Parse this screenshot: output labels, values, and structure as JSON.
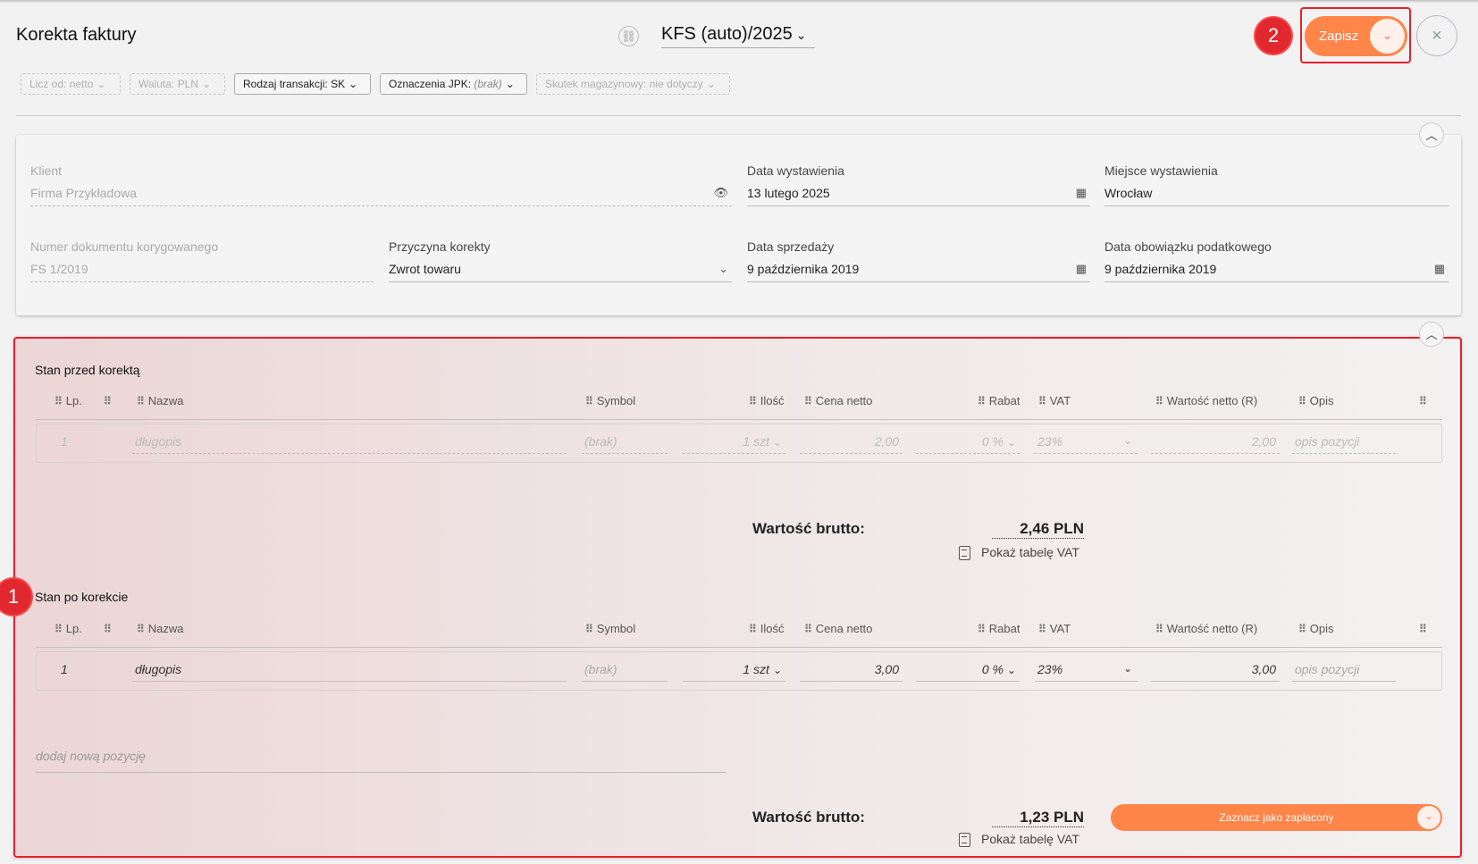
{
  "header": {
    "title": "Korekta faktury",
    "document_number": "KFS (auto)/2025",
    "save_label": "Zapisz",
    "close_label": "×",
    "badge_save": "2"
  },
  "filters": [
    {
      "label": "Licz od:",
      "value": "netto",
      "enabled": false
    },
    {
      "label": "Waluta:",
      "value": "PLN",
      "enabled": false
    },
    {
      "label": "Rodzaj transakcji:",
      "value": "SK",
      "enabled": true
    },
    {
      "label": "Oznaczenia JPK:",
      "value": "(brak)",
      "enabled": true
    },
    {
      "label": "Skutek magazynowy:",
      "value": "nie dotyczy",
      "enabled": false
    }
  ],
  "form": {
    "client_label": "Klient",
    "client_value": "Firma Przykładowa",
    "issue_date_label": "Data wystawienia",
    "issue_date_value": "13 lutego 2025",
    "place_label": "Miejsce wystawienia",
    "place_value": "Wrocław",
    "corrected_doc_label": "Numer dokumentu korygowanego",
    "corrected_doc_value": "FS 1/2019",
    "reason_label": "Przyczyna korekty",
    "reason_value": "Zwrot towaru",
    "sale_date_label": "Data sprzedaży",
    "sale_date_value": "9 października 2019",
    "tax_date_label": "Data obowiązku podatkowego",
    "tax_date_value": "9 października 2019"
  },
  "columns": [
    "Lp.",
    "",
    "Nazwa",
    "Symbol",
    "Ilość",
    "Cena netto",
    "Rabat",
    "VAT",
    "Wartość netto (R)",
    "Opis",
    ""
  ],
  "before": {
    "title": "Stan przed korektą",
    "row": {
      "lp": "1",
      "name": "długopis",
      "symbol": "(brak)",
      "qty": "1 szt",
      "price": "2,00",
      "discount": "0 %",
      "vat": "23%",
      "net": "2,00",
      "desc": "opis pozycji"
    },
    "gross_label": "Wartość brutto:",
    "gross_value": "2,46 PLN",
    "vat_table_link": "Pokaż tabelę VAT"
  },
  "after": {
    "badge": "1",
    "title": "Stan po korekcie",
    "row": {
      "lp": "1",
      "name": "długopis",
      "symbol": "(brak)",
      "qty": "1 szt",
      "price": "3,00",
      "discount": "0 %",
      "vat": "23%",
      "net": "3,00",
      "desc": "opis pozycji"
    },
    "add_position_placeholder": "dodaj nową pozycję",
    "gross_label": "Wartość brutto:",
    "gross_value": "1,23 PLN",
    "vat_table_link": "Pokaż tabelę VAT",
    "mark_paid_label": "Zaznacz jako zapłacony"
  },
  "colors": {
    "accent": "#ff8549",
    "highlight": "#e8202a"
  }
}
